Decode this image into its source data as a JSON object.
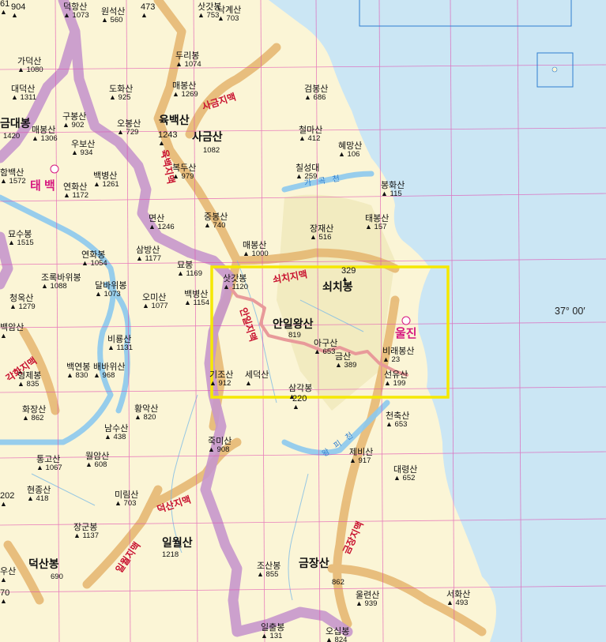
{
  "colors": {
    "sea": "#cbe6f4",
    "land": "#fbf5d6",
    "lowland": "#f2ebc0",
    "ridge_ochre": "#e5b56e",
    "province_border": "#c797cc",
    "river": "#8cc9ee",
    "grid_line": "#e04cb0",
    "highlight_box": "#f5e800",
    "trail": "#e89a9a",
    "range_label": "#c8102e",
    "city_label": "#d6177f"
  },
  "grid": {
    "longitude_label": "37° 00′"
  },
  "cities": [
    {
      "id": "taebaek",
      "name": "태 백"
    },
    {
      "id": "uljin",
      "name": "울진"
    }
  ],
  "ranges": [
    {
      "id": "sageum",
      "name": "사금지맥"
    },
    {
      "id": "ogbaek",
      "name": "육백지맥"
    },
    {
      "id": "soechi",
      "name": "쇠치지맥"
    },
    {
      "id": "anil",
      "name": "안일지맥"
    },
    {
      "id": "gakhwa",
      "name": "각화지맥"
    },
    {
      "id": "deoksan",
      "name": "덕산지맥"
    },
    {
      "id": "ilwol",
      "name": "일월지맥"
    },
    {
      "id": "geumjang",
      "name": "금장지맥"
    }
  ],
  "rivers": [
    {
      "id": "gagok",
      "name": "가 곡 천"
    },
    {
      "id": "wangpi",
      "name": "왕 피 천"
    }
  ],
  "major_peaks": [
    {
      "id": "ogbaeksan",
      "name": "육백산"
    },
    {
      "id": "sageumsan",
      "name": "사금산",
      "elev": "1082"
    },
    {
      "id": "soechibong",
      "name": "쇠치봉"
    },
    {
      "id": "anilwangsan",
      "name": "안일왕산",
      "elev": "819"
    },
    {
      "id": "geumjangsan",
      "name": "금장산",
      "elev": "862"
    },
    {
      "id": "deoksanbong",
      "name": "덕산봉",
      "elev": "690"
    },
    {
      "id": "ilwolsan",
      "name": "일월산",
      "elev": "1218"
    },
    {
      "id": "geumdaebong",
      "name": "금대봉",
      "elev": "1420"
    }
  ],
  "peaks": [
    {
      "name": "904",
      "elev": ""
    },
    {
      "name": "덕항산",
      "elev": "1073"
    },
    {
      "name": "원석산",
      "elev": "560"
    },
    {
      "name": "473",
      "elev": ""
    },
    {
      "name": "삿갓봉",
      "elev": "753"
    },
    {
      "name": "낙계산",
      "elev": "703"
    },
    {
      "name": "두리봉",
      "elev": "1074"
    },
    {
      "name": "가덕산",
      "elev": "1080"
    },
    {
      "name": "매봉산",
      "elev": "1269"
    },
    {
      "name": "도화산",
      "elev": "925"
    },
    {
      "name": "대덕산",
      "elev": "1311"
    },
    {
      "name": "검봉산",
      "elev": "686"
    },
    {
      "name": "구봉산",
      "elev": "902"
    },
    {
      "name": "오봉산",
      "elev": "729"
    },
    {
      "name": "1243",
      "elev": ""
    },
    {
      "name": "매봉산",
      "elev": "1306"
    },
    {
      "name": "우보산",
      "elev": "934"
    },
    {
      "name": "철마산",
      "elev": "412"
    },
    {
      "name": "혜망산",
      "elev": "106"
    },
    {
      "name": "함백산",
      "elev": "1572"
    },
    {
      "name": "연화산",
      "elev": "1172"
    },
    {
      "name": "백병산",
      "elev": "1261"
    },
    {
      "name": "복두산",
      "elev": "979"
    },
    {
      "name": "칠성대",
      "elev": "259"
    },
    {
      "name": "봉화산",
      "elev": "115"
    },
    {
      "name": "면산",
      "elev": "1246"
    },
    {
      "name": "중봉산",
      "elev": "740"
    },
    {
      "name": "태봉산",
      "elev": "157"
    },
    {
      "name": "묘수봉",
      "elev": "1515"
    },
    {
      "name": "장재산",
      "elev": "516"
    },
    {
      "name": "삼방산",
      "elev": "1177"
    },
    {
      "name": "연화봉",
      "elev": "1054"
    },
    {
      "name": "매봉산",
      "elev": "1000"
    },
    {
      "name": "조록바위봉",
      "elev": "1088"
    },
    {
      "name": "달바위봉",
      "elev": "1073"
    },
    {
      "name": "묘봉",
      "elev": "1169"
    },
    {
      "name": "삿갓봉",
      "elev": "1120"
    },
    {
      "name": "329",
      "elev": ""
    },
    {
      "name": "청옥산",
      "elev": "1279"
    },
    {
      "name": "오미산",
      "elev": "1077"
    },
    {
      "name": "백병산",
      "elev": "1154"
    },
    {
      "name": "아구산",
      "elev": "653"
    },
    {
      "name": "비래봉산",
      "elev": "23"
    },
    {
      "name": "금산",
      "elev": "389"
    },
    {
      "name": "비룡산",
      "elev": "1131"
    },
    {
      "name": "백연봉",
      "elev": "830"
    },
    {
      "name": "배바위산",
      "elev": "968"
    },
    {
      "name": "형제봉",
      "elev": "835"
    },
    {
      "name": "세덕산",
      "elev": ""
    },
    {
      "name": "기조산",
      "elev": "912"
    },
    {
      "name": "삼각봉",
      "elev": ""
    },
    {
      "name": "선유산",
      "elev": "199"
    },
    {
      "name": "화장산",
      "elev": "862"
    },
    {
      "name": "황악산",
      "elev": "820"
    },
    {
      "name": "220",
      "elev": ""
    },
    {
      "name": "천축산",
      "elev": "653"
    },
    {
      "name": "남수산",
      "elev": "438"
    },
    {
      "name": "죽미산",
      "elev": "908"
    },
    {
      "name": "통고산",
      "elev": "1067"
    },
    {
      "name": "월암산",
      "elev": "608"
    },
    {
      "name": "제비산",
      "elev": "917"
    },
    {
      "name": "대령산",
      "elev": "652"
    },
    {
      "name": "현종산",
      "elev": "418"
    },
    {
      "name": "미림산",
      "elev": "703"
    },
    {
      "name": "장군봉",
      "elev": "1137"
    },
    {
      "name": "조산봉",
      "elev": "855"
    },
    {
      "name": "울련산",
      "elev": "939"
    },
    {
      "name": "서화산",
      "elev": "493"
    },
    {
      "name": "일출봉",
      "elev": "131"
    },
    {
      "name": "오십봉",
      "elev": "824"
    },
    {
      "name": "백암산",
      "elev": ""
    },
    {
      "name": "202",
      "elev": ""
    },
    {
      "name": "우산",
      "elev": ""
    },
    {
      "name": "70",
      "elev": ""
    },
    {
      "name": "61",
      "elev": ""
    }
  ]
}
